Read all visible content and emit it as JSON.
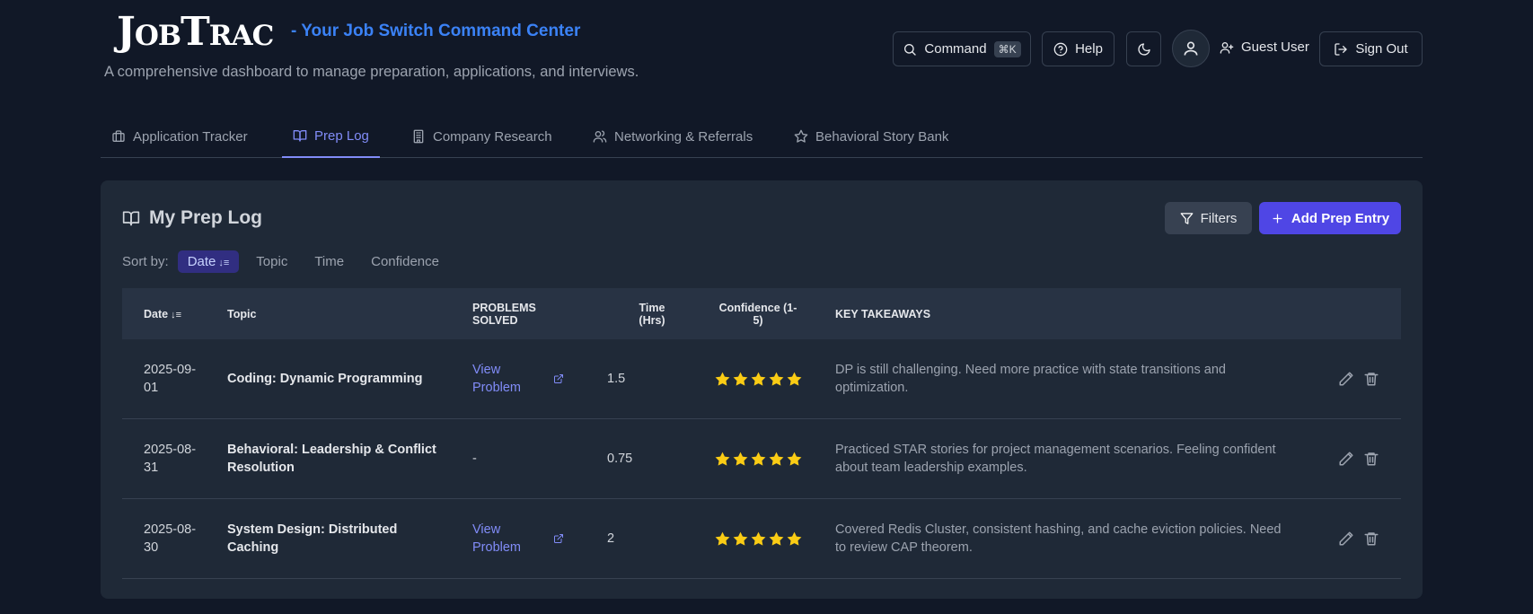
{
  "header": {
    "logo_big_1": "J",
    "logo_small_1": "OB",
    "logo_big_2": "T",
    "logo_small_2": "RAC",
    "tagline": "- Your Job Switch Command Center",
    "subtitle": "A comprehensive dashboard to manage preparation, applications, and interviews.",
    "command_label": "Command",
    "command_shortcut": "⌘K",
    "help_label": "Help",
    "user_name": "Guest User",
    "signout_label": "Sign Out"
  },
  "tabs": [
    {
      "label": "Application Tracker",
      "icon": "briefcase-icon"
    },
    {
      "label": "Prep Log",
      "icon": "book-open-icon",
      "active": true
    },
    {
      "label": "Company Research",
      "icon": "building-icon"
    },
    {
      "label": "Networking & Referrals",
      "icon": "users-icon"
    },
    {
      "label": "Behavioral Story Bank",
      "icon": "star-icon"
    }
  ],
  "card": {
    "title": "My Prep Log",
    "filters_label": "Filters",
    "add_label": "Add Prep Entry",
    "sort_label": "Sort by:",
    "sort_options": [
      "Date",
      "Topic",
      "Time",
      "Confidence"
    ],
    "sort_active": "Date",
    "sort_arrow": "↓≡"
  },
  "table": {
    "headers": {
      "date": "Date",
      "topic": "Topic",
      "problems_1": "PROBLEMS",
      "problems_2": "SOLVED",
      "time_1": "Time",
      "time_2": "(Hrs)",
      "conf_1": "Confidence (1-",
      "conf_2": "5)",
      "takeaways": "KEY TAKEAWAYS"
    },
    "rows": [
      {
        "date_1": "2025-09-",
        "date_2": "01",
        "topic": "Coding: Dynamic Programming",
        "problems": "View Problem",
        "time": "1.5",
        "confidence": 5,
        "takeaways": "DP is still challenging. Need more practice with state transitions and optimization."
      },
      {
        "date_1": "2025-08-",
        "date_2": "31",
        "topic": "Behavioral: Leadership & Conflict Resolution",
        "problems": "-",
        "time": "0.75",
        "confidence": 5,
        "takeaways": "Practiced STAR stories for project management scenarios. Feeling confident about team leadership examples."
      },
      {
        "date_1": "2025-08-",
        "date_2": "30",
        "topic": "System Design: Distributed Caching",
        "problems": "View Problem",
        "time": "2",
        "confidence": 5,
        "takeaways": "Covered Redis Cluster, consistent hashing, and cache eviction policies. Need to review CAP theorem."
      }
    ]
  },
  "colors": {
    "background": "#111827",
    "card": "#1f2937",
    "accent": "#4f46e5",
    "link": "#818cf8",
    "tagline": "#3b82f6",
    "star": "#facc15"
  }
}
